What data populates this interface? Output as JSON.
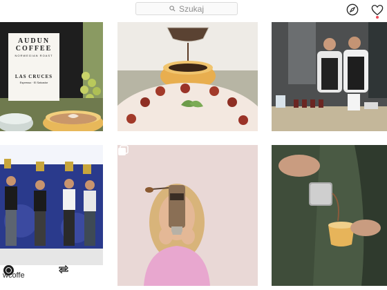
{
  "search": {
    "placeholder": "Szukaj"
  },
  "header": {
    "explore_icon": "compass-icon",
    "activity_icon": "heart-icon",
    "notification_color": "#ed4956"
  },
  "tiles": [
    {
      "bag_brand_line1": "AUDUN",
      "bag_brand_line2": "COFFEE",
      "bag_subtitle": "NORWEGIAN ROAST",
      "bag_coffee_name": "LAS CRUCES",
      "bag_origin": "Espresso · El Salvador"
    },
    {
      "content": "coffee-pouring-cake-photo"
    },
    {
      "content": "baristas-competition-photo"
    },
    {
      "repost_icon": "repost-icon",
      "repost_user": "wcoffe"
    },
    {
      "multi_icon": "multiple-photos-icon"
    },
    {
      "content": "milk-pitcher-pour-photo"
    }
  ]
}
